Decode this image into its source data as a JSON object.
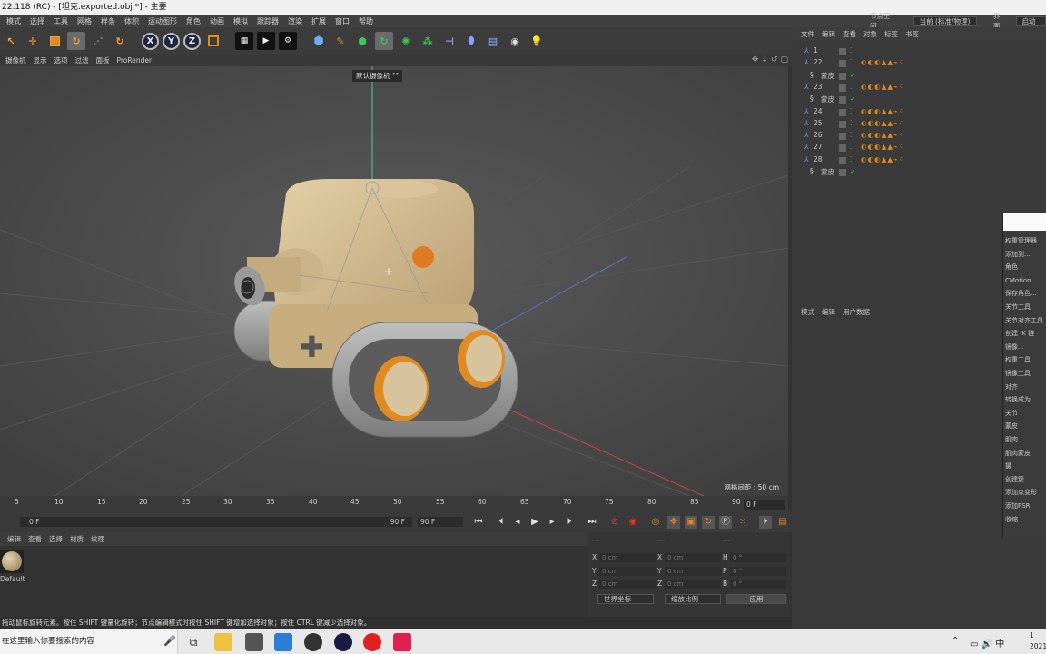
{
  "title": "22.118 (RC) - [坦克.exported.obj *] - 主要",
  "menu": [
    "模式",
    "选择",
    "工具",
    "网格",
    "样条",
    "体积",
    "运动图形",
    "角色",
    "动画",
    "模拟",
    "跟踪器",
    "渲染",
    "扩展",
    "窗口",
    "帮助"
  ],
  "layout": {
    "label": "节点空间:",
    "node_space": "当前 (标准/物理)",
    "interface_label": "界面",
    "interface_value": "启动"
  },
  "viewport_menu": [
    "摄像机",
    "显示",
    "选项",
    "过滤",
    "面板",
    "ProRender"
  ],
  "viewport": {
    "camera_label": "默认摄像机 °°",
    "grid_spacing": "网格间距 : 50 cm"
  },
  "timeline": {
    "ticks": [
      "5",
      "10",
      "15",
      "20",
      "25",
      "30",
      "35",
      "40",
      "45",
      "50",
      "55",
      "60",
      "65",
      "70",
      "75",
      "80",
      "85",
      "90"
    ],
    "current_frame": "0 F",
    "range_start": "0 F",
    "range_end": "90 F",
    "max_frame": "90 F"
  },
  "material_menu": [
    "编辑",
    "查看",
    "选择",
    "材质",
    "纹理"
  ],
  "material": {
    "name": "Default"
  },
  "coords": {
    "rows": [
      {
        "a": "X",
        "av": "0 cm",
        "b": "X",
        "bv": "0 cm",
        "c": "H",
        "cv": "0 °"
      },
      {
        "a": "Y",
        "av": "0 cm",
        "b": "Y",
        "bv": "0 cm",
        "c": "P",
        "cv": "0 °"
      },
      {
        "a": "Z",
        "av": "0 cm",
        "b": "Z",
        "bv": "0 cm",
        "c": "B",
        "cv": "0 °"
      }
    ],
    "world": "世界坐标",
    "scale": "缩放比例",
    "apply": "应用",
    "top_left": "---",
    "top_mid": "---",
    "top_right": "---"
  },
  "status": "拖动鼠标旋转元素。按住 SHIFT 键量化旋转；节点编辑模式时按住 SHIFT 键增加选择对象；按住 CTRL 键减少选择对象。",
  "object_menu": [
    "文件",
    "编辑",
    "查看",
    "对象",
    "标签",
    "书签"
  ],
  "objects": [
    {
      "name": "1",
      "child": false
    },
    {
      "name": "22",
      "child": false
    },
    {
      "name": "蒙皮",
      "child": true
    },
    {
      "name": "23",
      "child": false
    },
    {
      "name": "蒙皮",
      "child": true
    },
    {
      "name": "24",
      "child": false
    },
    {
      "name": "25",
      "child": false
    },
    {
      "name": "26",
      "child": false
    },
    {
      "name": "27",
      "child": false
    },
    {
      "name": "28",
      "child": false
    },
    {
      "name": "蒙皮",
      "child": true
    }
  ],
  "attr_menu": [
    "模式",
    "编辑",
    "用户数据"
  ],
  "palette": [
    "权重管理器",
    "添加到...",
    "角色",
    "CMotion",
    "保存角色...",
    "关节工具",
    "关节对齐工具",
    "创建 IK 链",
    "镜像...",
    "权重工具",
    "镜像工具",
    "对齐",
    "转换成为...",
    "关节",
    "蒙皮",
    "肌肉",
    "肌肉蒙皮",
    "摄",
    "创建簇",
    "添加点变形",
    "添加PSR",
    "收缩"
  ],
  "taskbar": {
    "search": "在这里输入你要搜索的内容",
    "time": "1",
    "date": "2021"
  }
}
